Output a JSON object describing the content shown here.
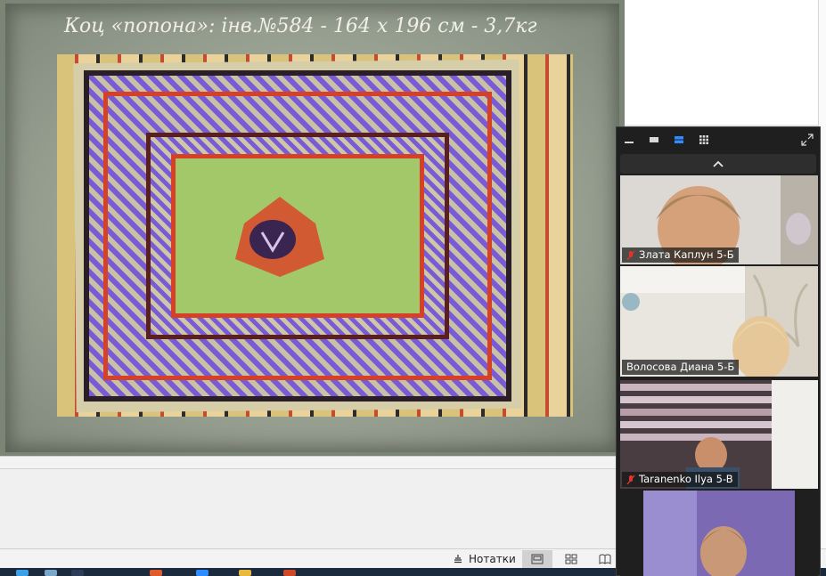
{
  "slide": {
    "title": "Коц «попона»: інв.№584 - 164 х 196 см - 3,7кг"
  },
  "status_bar": {
    "notes_label": "Нотатки"
  },
  "zoom": {
    "participants": [
      {
        "name": "Злата Каплун 5-Б",
        "muted": true
      },
      {
        "name": "Волосова Диана 5-Б",
        "muted": false
      },
      {
        "name": "Taranenko Ilya 5-B",
        "muted": true
      },
      {
        "name": "",
        "muted": false
      }
    ]
  },
  "colors": {
    "slide_bg": "#7b8576",
    "panel_bg": "#1f1f1f",
    "accent_blue": "#2d8cff",
    "muted_red": "#e0352b"
  }
}
